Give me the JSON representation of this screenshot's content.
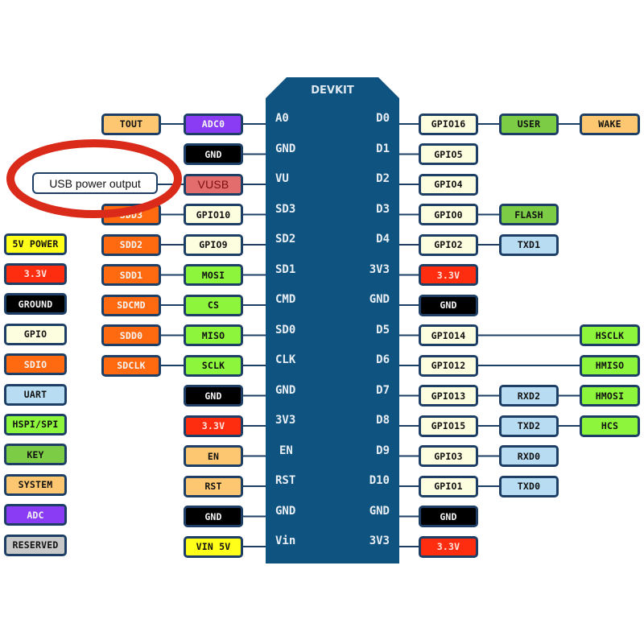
{
  "colors": {
    "chip": "#0f5480",
    "border": "#1d3f66",
    "gpio": "#fdfde0",
    "sdio": "#ff6a10",
    "power_5v": "#ffff1a",
    "power_3v3": "#ff2d10",
    "ground": "#000000",
    "uart": "#b8dcf2",
    "hspi": "#8cf53c",
    "key": "#7ccc46",
    "system": "#fdc771",
    "adc": "#8a3cf5",
    "reserved": "#c8c8c8",
    "vusb": "#e36c6c",
    "highlight_ring": "#d92a1a"
  },
  "chip": {
    "title": "DEVKIT",
    "left_pins": [
      "A0",
      "GND",
      "VU",
      "SD3",
      "SD2",
      "SD1",
      "CMD",
      "SD0",
      "CLK",
      "GND",
      "3V3",
      "EN",
      "RST",
      "GND",
      "Vin"
    ],
    "right_pins": [
      "D0",
      "D1",
      "D2",
      "D3",
      "D4",
      "3V3",
      "GND",
      "D5",
      "D6",
      "D7",
      "D8",
      "D9",
      "D10",
      "GND",
      "3V3"
    ]
  },
  "left_inner": [
    {
      "label": "ADC0",
      "type": "adc"
    },
    {
      "label": "GND",
      "type": "ground"
    },
    {
      "label": "VUSB",
      "type": "vusb"
    },
    {
      "label": "GPIO10",
      "type": "gpio"
    },
    {
      "label": "GPIO9",
      "type": "gpio"
    },
    {
      "label": "MOSI",
      "type": "hspi"
    },
    {
      "label": "CS",
      "type": "hspi"
    },
    {
      "label": "MISO",
      "type": "hspi"
    },
    {
      "label": "SCLK",
      "type": "hspi"
    },
    {
      "label": "GND",
      "type": "ground"
    },
    {
      "label": "3.3V",
      "type": "power_3v3"
    },
    {
      "label": "EN",
      "type": "system"
    },
    {
      "label": "RST",
      "type": "system"
    },
    {
      "label": "GND",
      "type": "ground"
    },
    {
      "label": "VIN 5V",
      "type": "power_5v"
    }
  ],
  "left_outer": [
    {
      "row": 0,
      "label": "TOUT",
      "type": "system"
    },
    {
      "row": 3,
      "label": "SDD3",
      "type": "sdio"
    },
    {
      "row": 4,
      "label": "SDD2",
      "type": "sdio"
    },
    {
      "row": 5,
      "label": "SDD1",
      "type": "sdio"
    },
    {
      "row": 6,
      "label": "SDCMD",
      "type": "sdio"
    },
    {
      "row": 7,
      "label": "SDD0",
      "type": "sdio"
    },
    {
      "row": 8,
      "label": "SDCLK",
      "type": "sdio"
    }
  ],
  "right_inner": [
    {
      "label": "GPIO16",
      "type": "gpio"
    },
    {
      "label": "GPIO5",
      "type": "gpio"
    },
    {
      "label": "GPIO4",
      "type": "gpio"
    },
    {
      "label": "GPIO0",
      "type": "gpio"
    },
    {
      "label": "GPIO2",
      "type": "gpio"
    },
    {
      "label": "3.3V",
      "type": "power_3v3"
    },
    {
      "label": "GND",
      "type": "ground"
    },
    {
      "label": "GPIO14",
      "type": "gpio"
    },
    {
      "label": "GPIO12",
      "type": "gpio"
    },
    {
      "label": "GPIO13",
      "type": "gpio"
    },
    {
      "label": "GPIO15",
      "type": "gpio"
    },
    {
      "label": "GPIO3",
      "type": "gpio"
    },
    {
      "label": "GPIO1",
      "type": "gpio"
    },
    {
      "label": "GND",
      "type": "ground"
    },
    {
      "label": "3.3V",
      "type": "power_3v3"
    }
  ],
  "right_mid": [
    {
      "row": 0,
      "label": "USER",
      "type": "key"
    },
    {
      "row": 3,
      "label": "FLASH",
      "type": "key"
    },
    {
      "row": 4,
      "label": "TXD1",
      "type": "uart"
    },
    {
      "row": 9,
      "label": "RXD2",
      "type": "uart"
    },
    {
      "row": 10,
      "label": "TXD2",
      "type": "uart"
    },
    {
      "row": 11,
      "label": "RXD0",
      "type": "uart"
    },
    {
      "row": 12,
      "label": "TXD0",
      "type": "uart"
    }
  ],
  "right_outer": [
    {
      "row": 0,
      "label": "WAKE",
      "type": "system"
    },
    {
      "row": 7,
      "label": "HSCLK",
      "type": "hspi"
    },
    {
      "row": 8,
      "label": "HMISO",
      "type": "hspi"
    },
    {
      "row": 9,
      "label": "HMOSI",
      "type": "hspi"
    },
    {
      "row": 10,
      "label": "HCS",
      "type": "hspi"
    }
  ],
  "legend": [
    {
      "label": "5V POWER",
      "type": "power_5v"
    },
    {
      "label": "3.3V",
      "type": "power_3v3"
    },
    {
      "label": "GROUND",
      "type": "ground"
    },
    {
      "label": "GPIO",
      "type": "gpio"
    },
    {
      "label": "SDIO",
      "type": "sdio"
    },
    {
      "label": "UART",
      "type": "uart"
    },
    {
      "label": "HSPI/SPI",
      "type": "hspi"
    },
    {
      "label": "KEY",
      "type": "key"
    },
    {
      "label": "SYSTEM",
      "type": "system"
    },
    {
      "label": "ADC",
      "type": "adc"
    },
    {
      "label": "RESERVED",
      "type": "reserved"
    }
  ],
  "annotation": {
    "callout_text": "USB power output"
  }
}
